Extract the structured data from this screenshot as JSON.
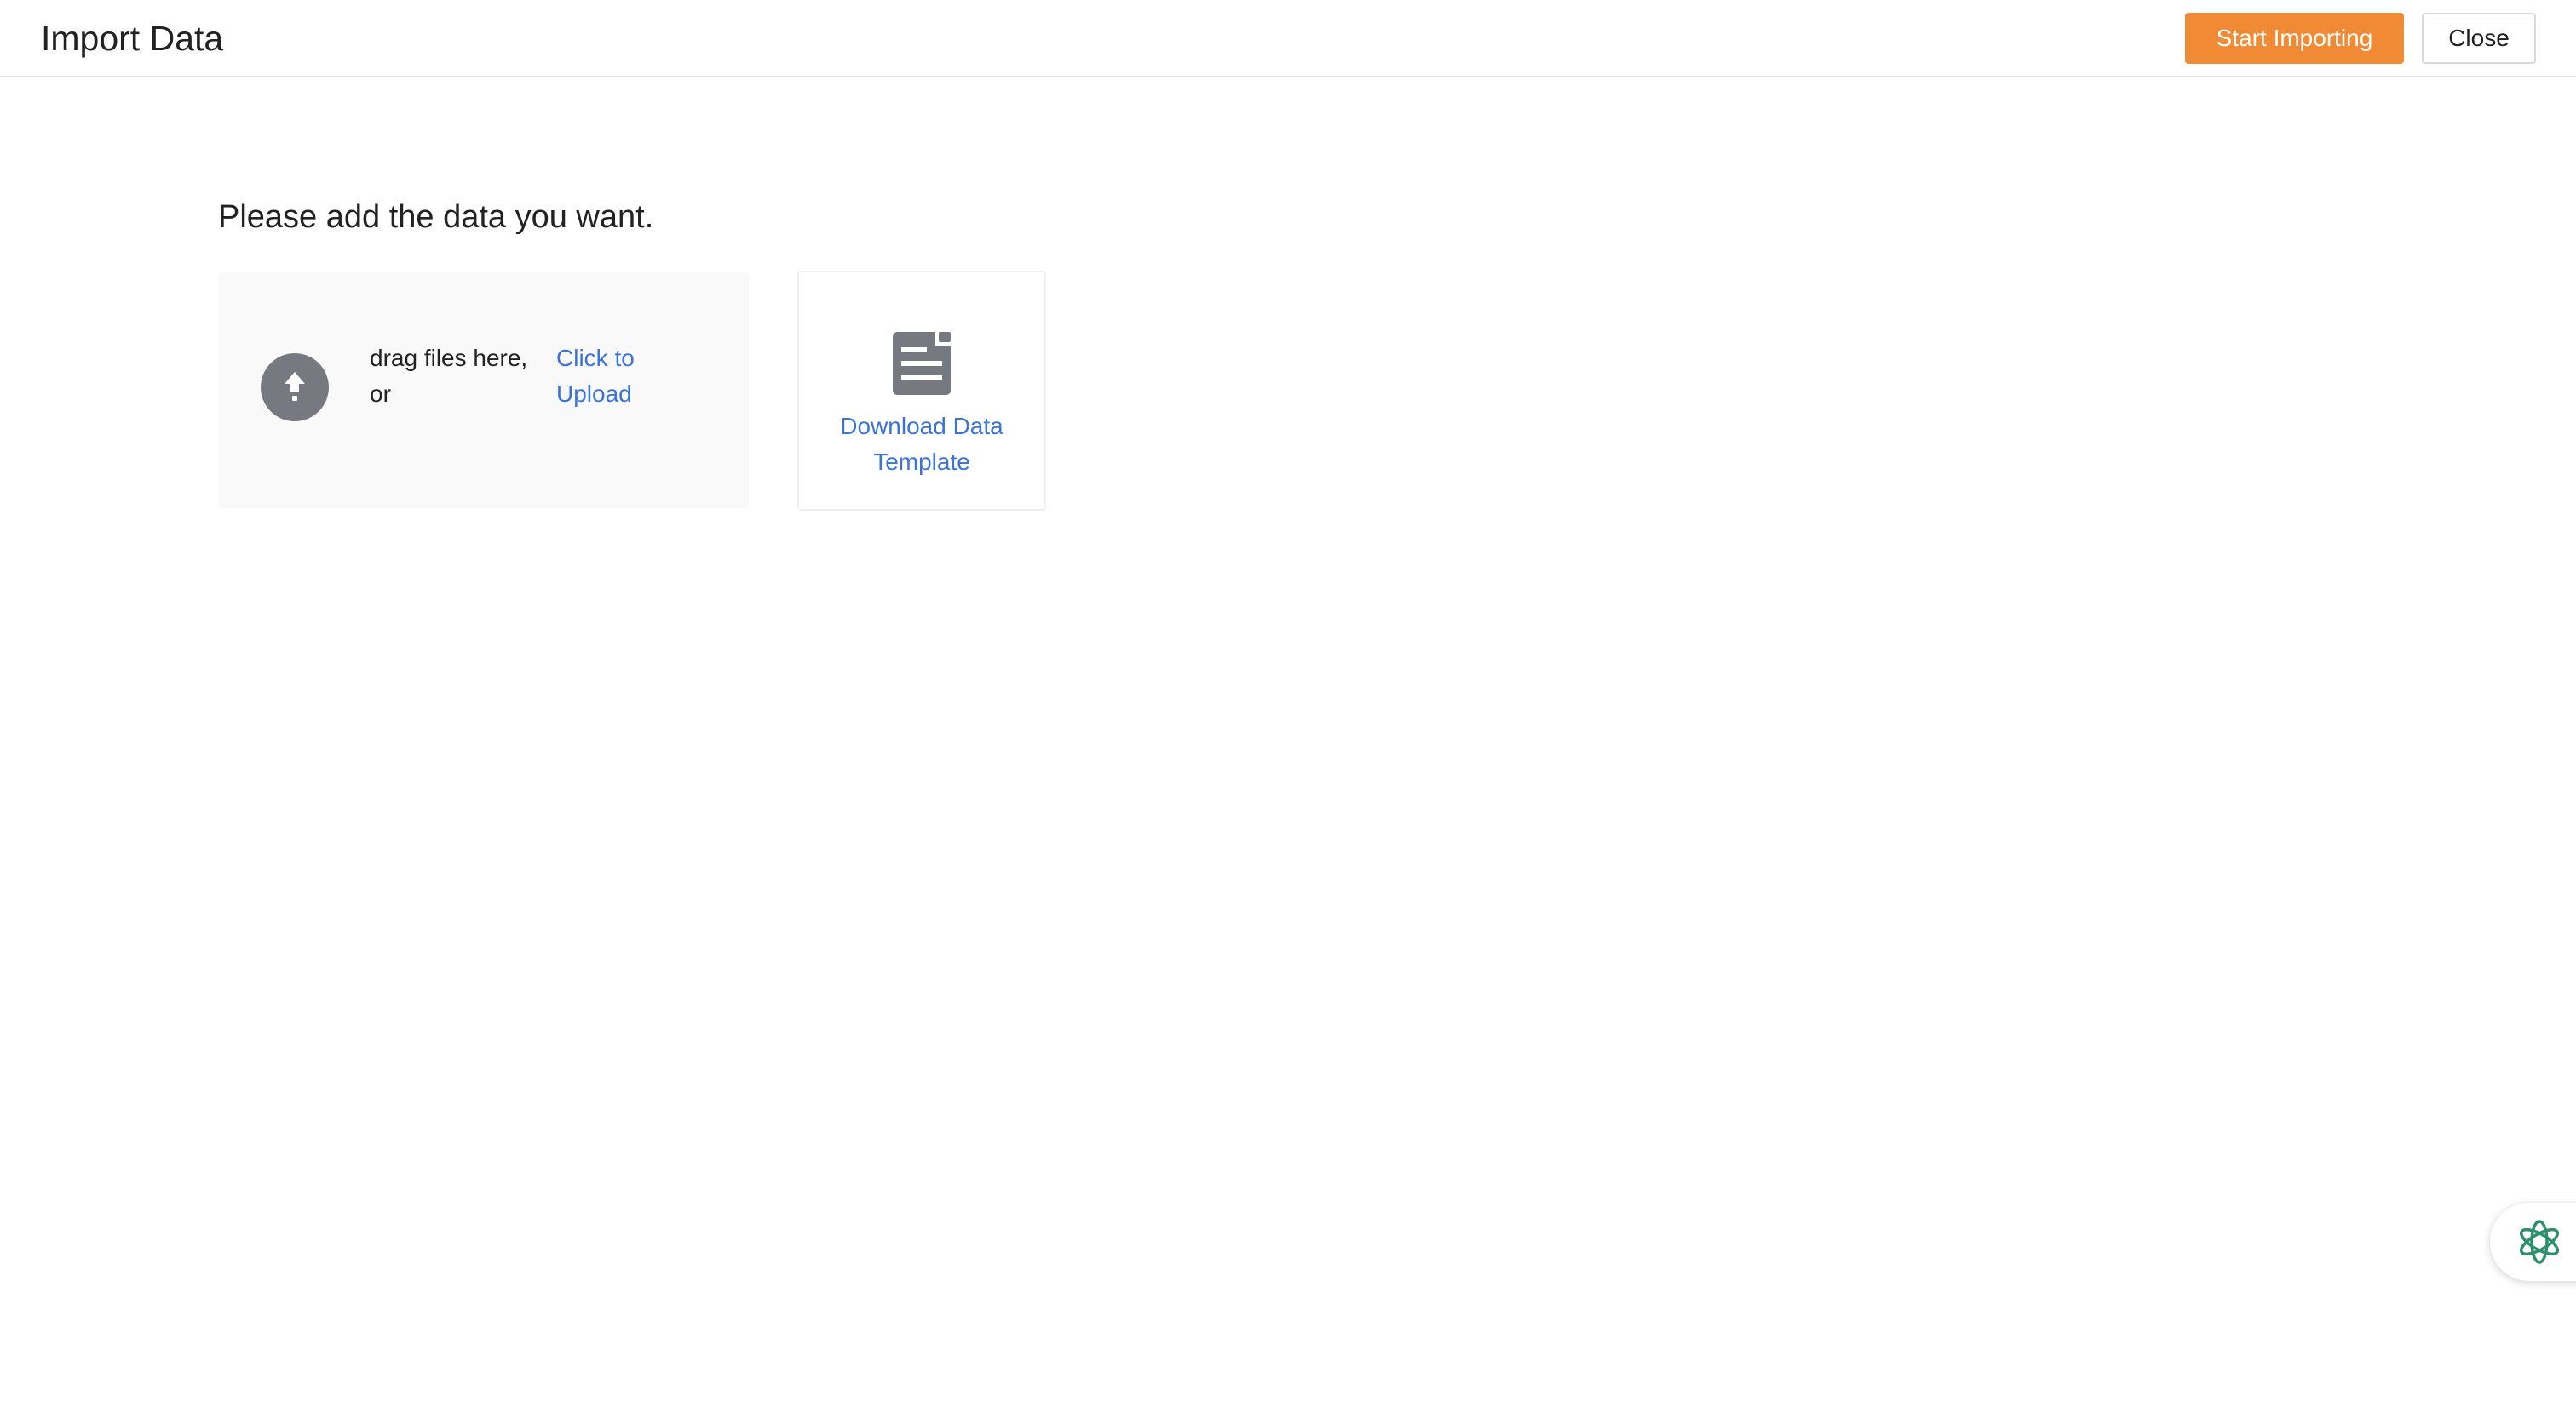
{
  "header": {
    "title": "Import Data",
    "start_label": "Start Importing",
    "close_label": "Close"
  },
  "main": {
    "prompt": "Please add the data you want.",
    "dropzone": {
      "drag_text": "drag files here, or",
      "upload_link": "Click to Upload",
      "icon": "upload-arrow-icon"
    },
    "template": {
      "label": "Download Data Template",
      "icon": "document-icon"
    }
  },
  "floating": {
    "icon": "ai-assistant-icon"
  },
  "colors": {
    "primary": "#f08a34",
    "link": "#3a73d9",
    "icon_gray": "#767980",
    "assistant_green": "#2e8f6a"
  }
}
